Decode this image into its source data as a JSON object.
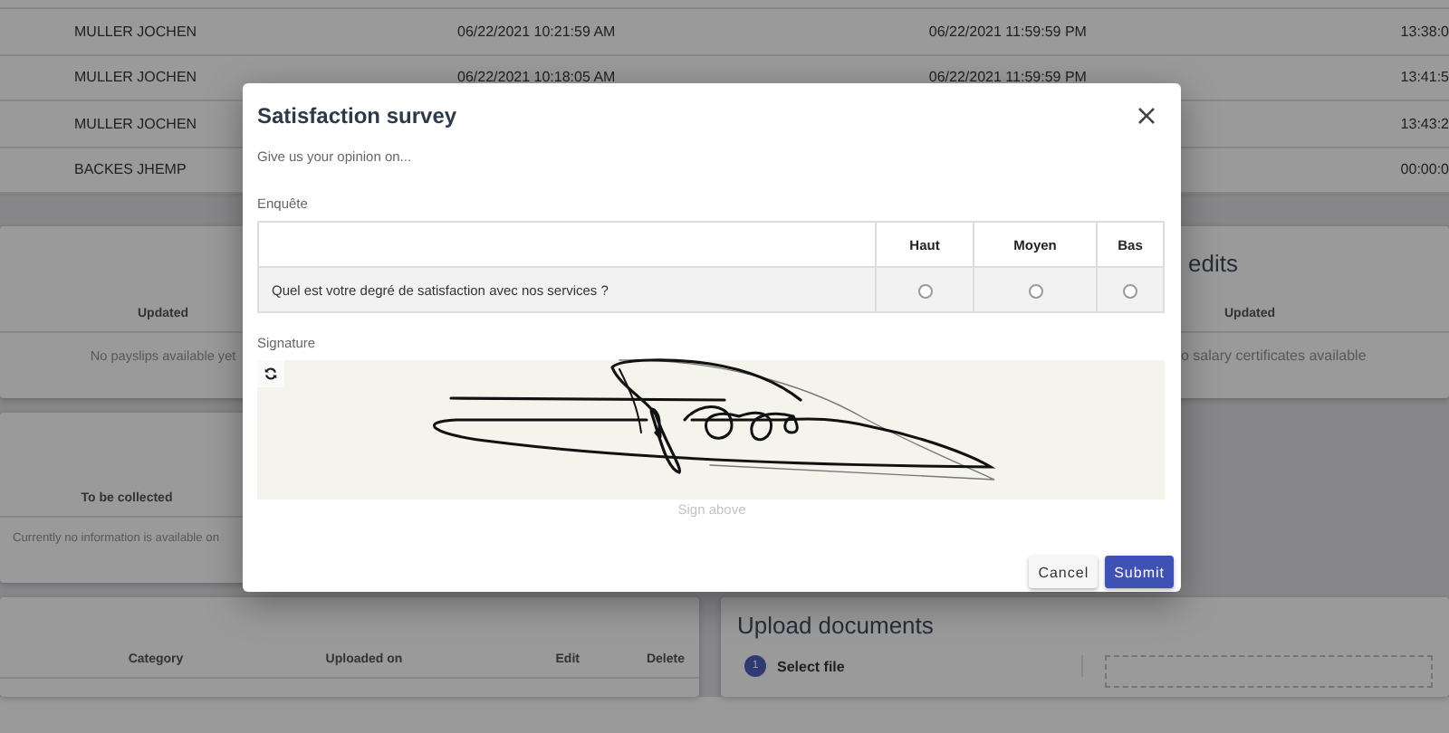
{
  "background_table": {
    "rows": [
      {
        "name": "MULLER JOCHEN",
        "start": "06/22/2021 10:21:59 AM",
        "end": "06/22/2021 11:59:59 PM",
        "column_4": "13:38:0"
      },
      {
        "name": "MULLER JOCHEN",
        "start": "06/22/2021 10:18:05 AM",
        "end": "06/22/2021 11:59:59 PM",
        "column_4": "13:41:5"
      },
      {
        "name": "MULLER JOCHEN",
        "start": "",
        "end": "",
        "column_4": "13:43:2"
      },
      {
        "name": "BACKES JHEMP",
        "start": "",
        "end": "",
        "column_4": "00:00:0"
      }
    ]
  },
  "payslips_card": {
    "column_header": "Updated",
    "empty_message": "No payslips available yet"
  },
  "certificates_card": {
    "title": "edits",
    "column_header": "Updated",
    "empty_message": "o salary certificates available"
  },
  "collection_card": {
    "column_header": "To be collected",
    "empty_message": "Currently no information is available on"
  },
  "documents_card": {
    "columns": [
      "Category",
      "Uploaded on",
      "Edit",
      "Delete"
    ]
  },
  "upload_card": {
    "title": "Upload documents",
    "steps": [
      {
        "number": "1",
        "label": "Select file"
      }
    ]
  },
  "dialog": {
    "title": "Satisfaction survey",
    "intro": "Give us your opinion on...",
    "survey": {
      "label": "Enquête",
      "columns": [
        "Haut",
        "Moyen",
        "Bas"
      ],
      "rows": [
        {
          "question": "Quel est votre degré de satisfaction avec nos services ?",
          "options": [
            {
              "selected": false
            },
            {
              "selected": false
            },
            {
              "selected": false
            }
          ]
        }
      ]
    },
    "signature": {
      "label": "Signature",
      "hint": "Sign above"
    },
    "buttons": [
      {
        "label": "Cancel",
        "kind": "secondary"
      },
      {
        "label": "Submit",
        "kind": "primary"
      }
    ]
  }
}
